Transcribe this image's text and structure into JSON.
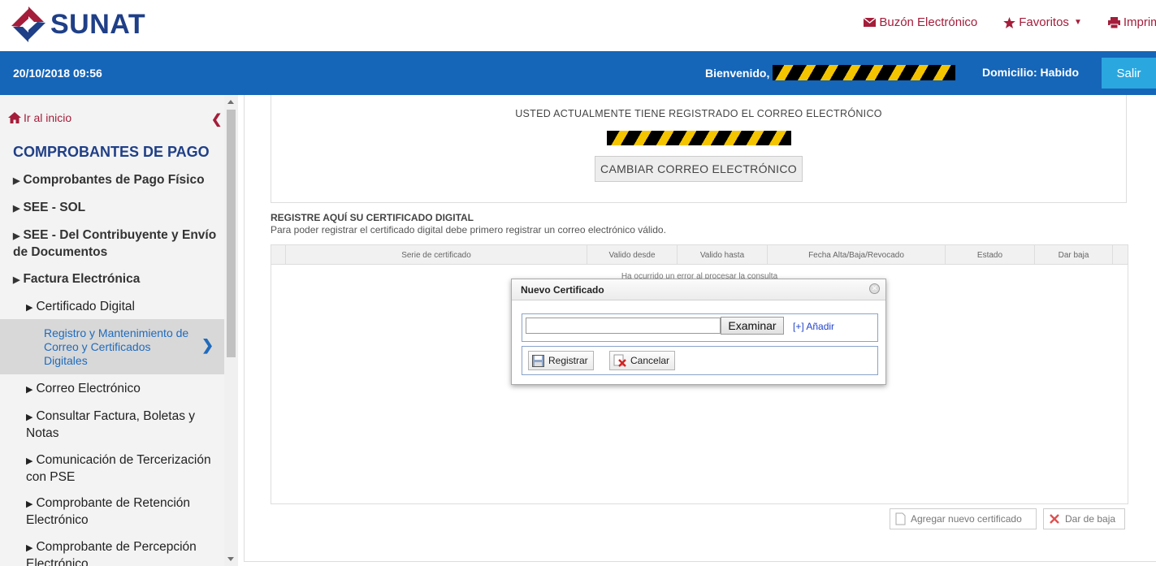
{
  "header": {
    "brand": "SUNAT",
    "links": [
      {
        "label": "Buzón Electrónico",
        "icon": "envelope-icon"
      },
      {
        "label": "Favoritos",
        "icon": "star-icon"
      },
      {
        "label": "Imprimir",
        "icon": "printer-icon"
      }
    ]
  },
  "bar": {
    "datetime": "20/10/2018 09:56",
    "welcome": "Bienvenido,",
    "domicilio": "Domicilio: Habido",
    "salir": "Salir"
  },
  "sidebar": {
    "home": "Ir al inicio",
    "title": "COMPROBANTES DE PAGO",
    "items": [
      "Comprobantes de Pago Físico",
      "SEE - SOL",
      "SEE - Del Contribuyente y Envío de Documentos",
      "Factura Electrónica"
    ],
    "subitems": [
      "Certificado Digital",
      "Correo Electrónico",
      "Consultar Factura, Boletas y Notas",
      "Comunicación de Tercerización con PSE",
      "Comprobante de Retención Electrónico",
      "Comprobante de Percepción Electrónico"
    ],
    "active": "Registro y Mantenimiento de Correo y Certificados Digitales"
  },
  "email": {
    "title": "USTED ACTUALMENTE TIENE REGISTRADO EL CORREO ELECTRÓNICO",
    "button": "CAMBIAR CORREO ELECTRÓNICO"
  },
  "cert": {
    "title": "REGISTRE AQUÍ SU CERTIFICADO DIGITAL",
    "subtitle": "Para poder registrar el certificado digital debe primero registrar un correo electrónico válido.",
    "columns": [
      "Serie de certificado",
      "Valido desde",
      "Valido hasta",
      "Fecha Alta/Baja/Revocado",
      "Estado",
      "Dar baja"
    ],
    "message": "Ha ocurrido un error al procesar la consulta",
    "add_button": "Agregar nuevo certificado",
    "remove_button": "Dar de baja"
  },
  "modal": {
    "title": "Nuevo Certificado",
    "browse": "Examinar",
    "add": "[+] Añadir",
    "register": "Registrar",
    "cancel": "Cancelar"
  }
}
